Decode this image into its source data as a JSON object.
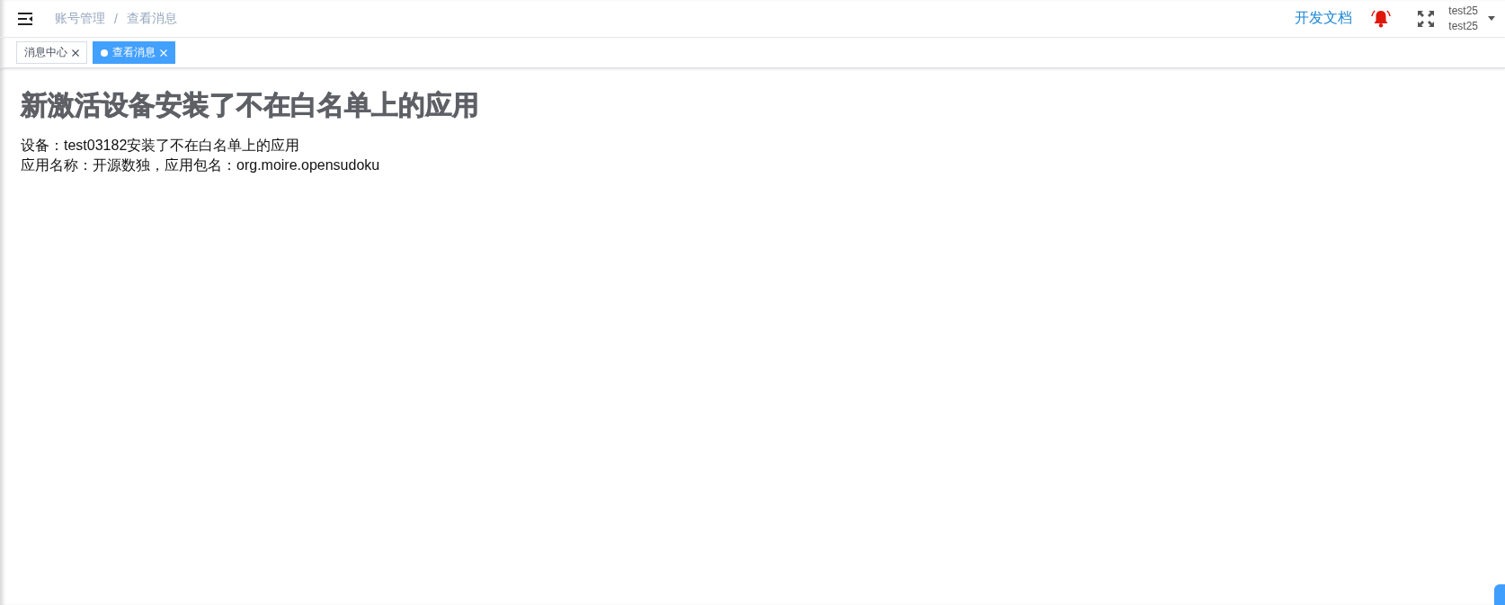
{
  "header": {
    "breadcrumb": [
      {
        "label": "账号管理"
      },
      {
        "label": "查看消息"
      }
    ],
    "breadcrumb_separator": "/",
    "doc_link": "开发文档",
    "user": {
      "name": "test25",
      "account": "test25"
    }
  },
  "tabs": [
    {
      "label": "消息中心",
      "selected": false
    },
    {
      "label": "查看消息",
      "selected": true
    }
  ],
  "message": {
    "title": "新激活设备安装了不在白名单上的应用",
    "lines": [
      "设备：test03182安装了不在白名单上的应用",
      "应用名称：开源数独，应用包名：org.moire.opensudoku"
    ]
  }
}
